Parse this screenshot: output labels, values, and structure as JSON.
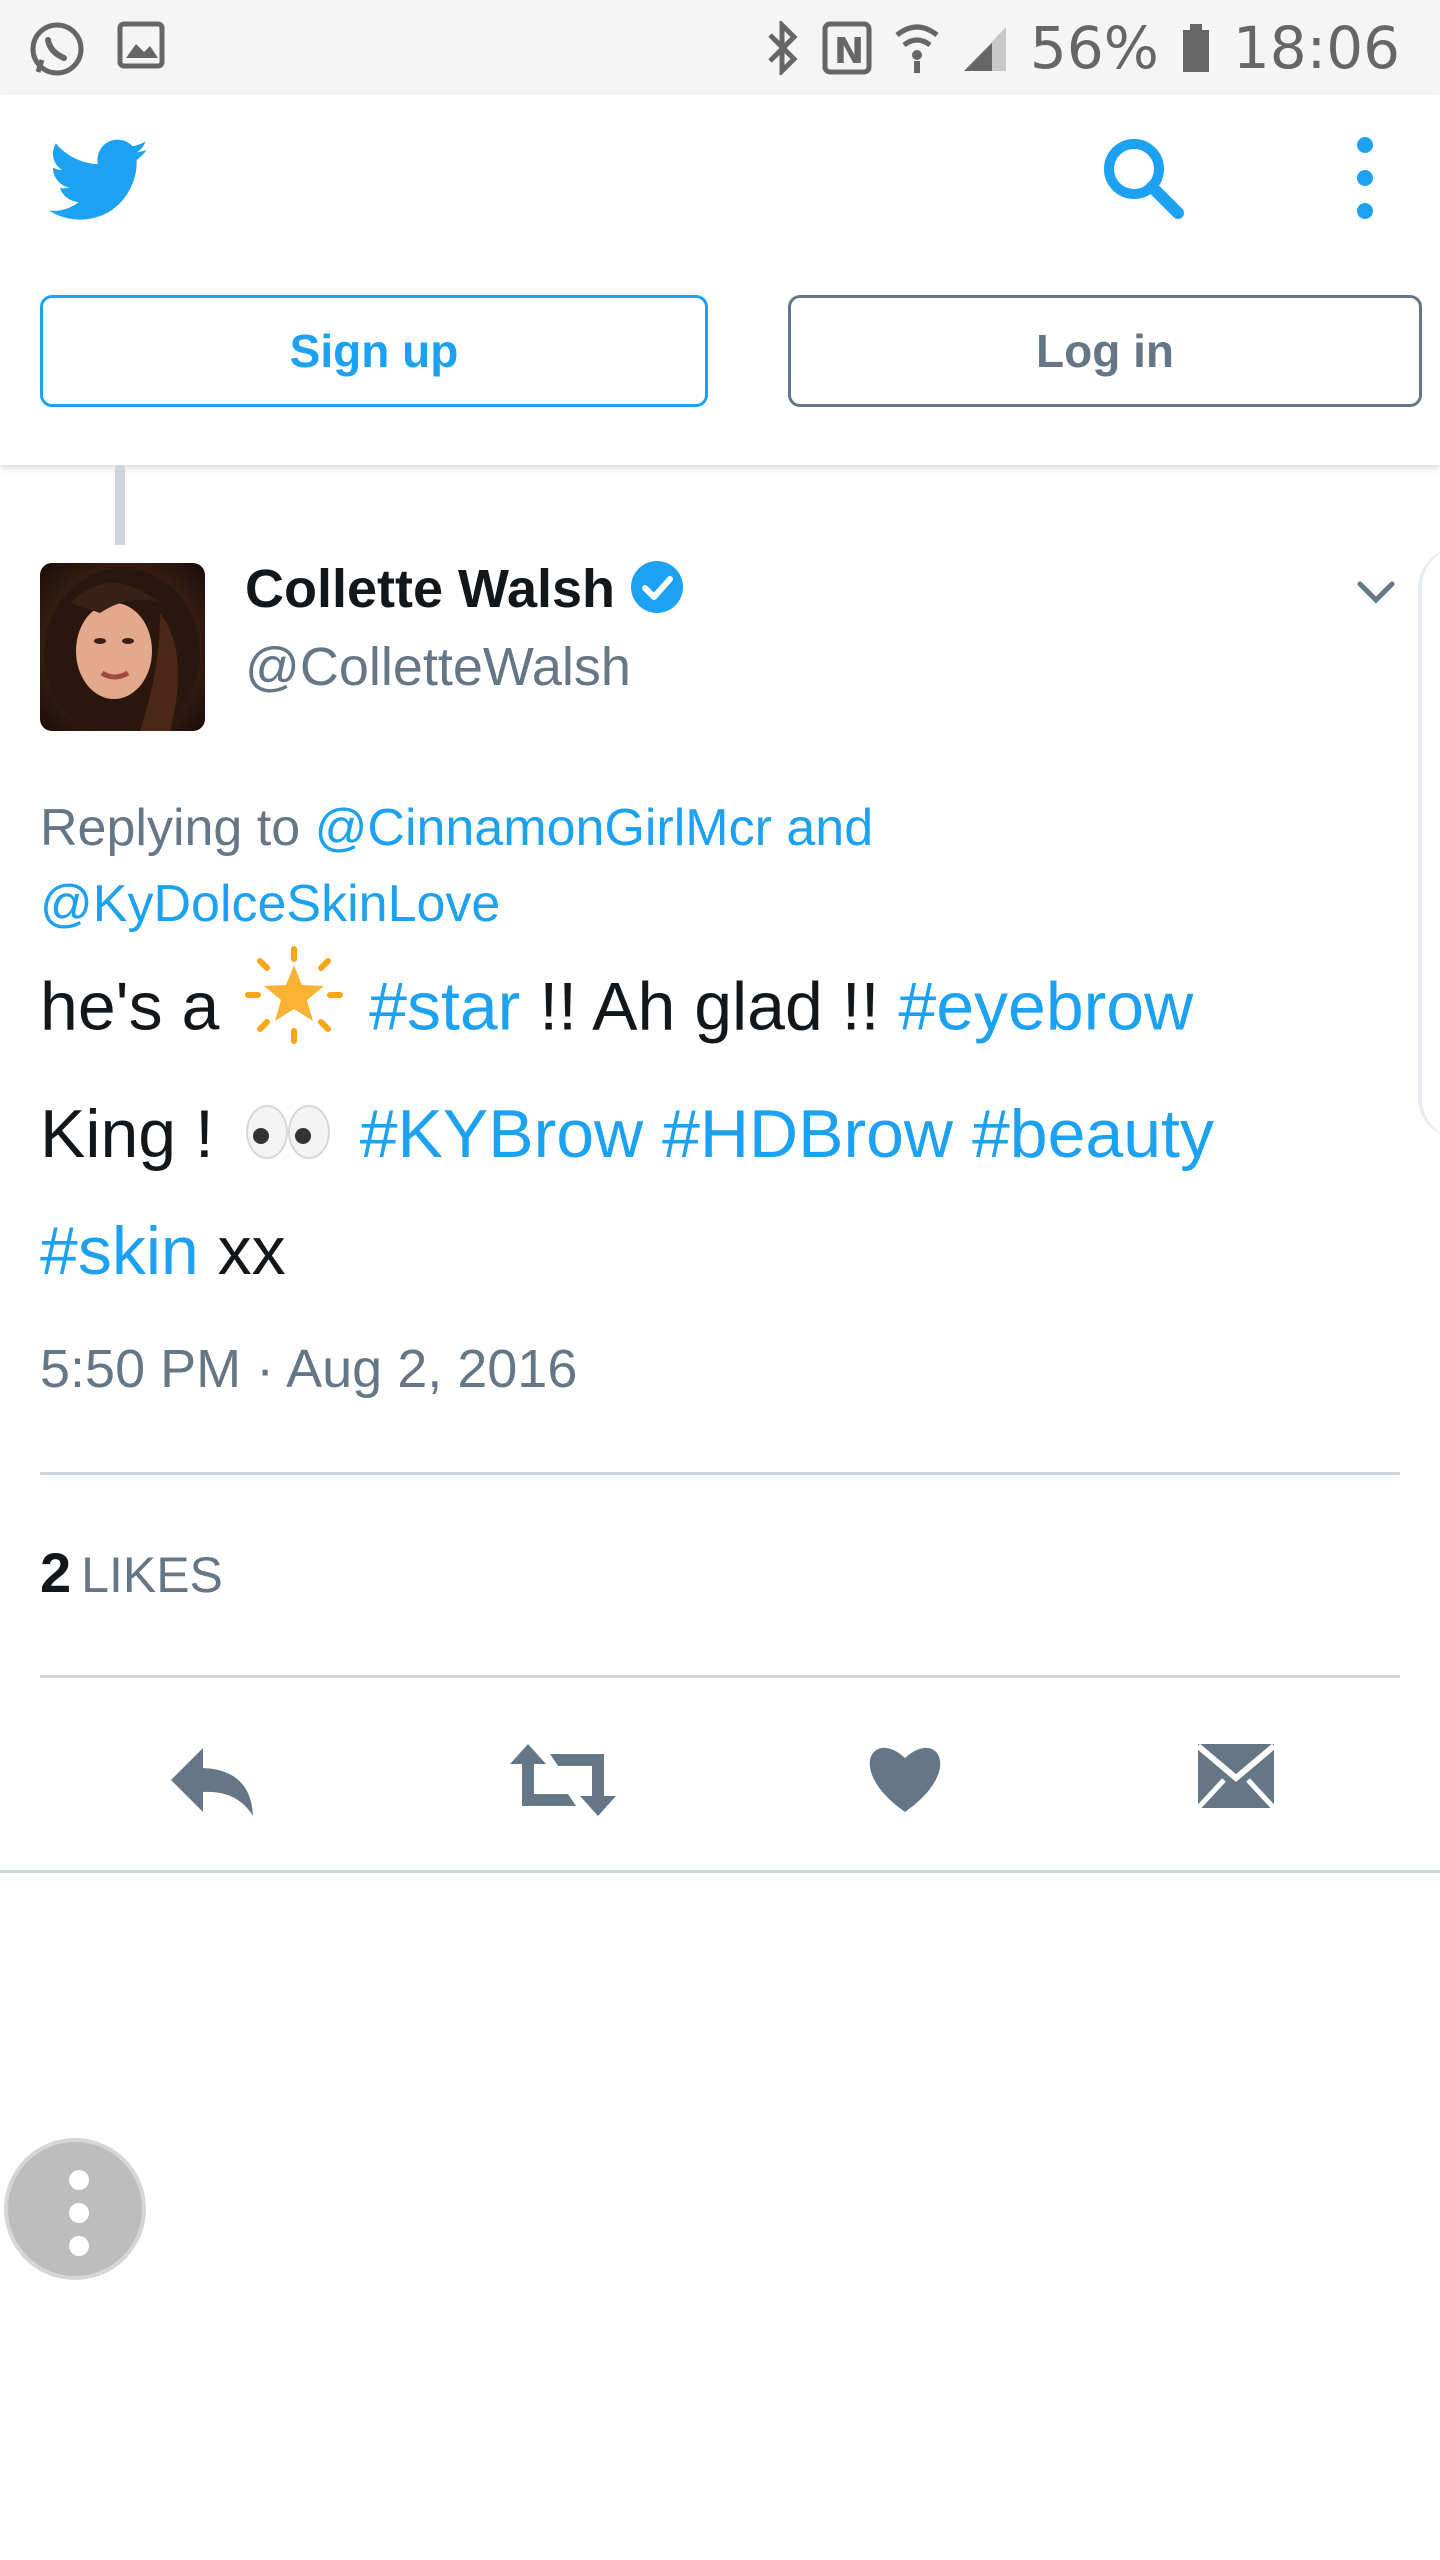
{
  "status_bar": {
    "battery_text": "56%",
    "time": "18:06"
  },
  "header": {
    "logo": "twitter-bird-icon",
    "signup_label": "Sign up",
    "login_label": "Log in"
  },
  "tweet": {
    "name": "Collette Walsh",
    "handle": "@ColletteWalsh",
    "verified": true,
    "replying_prefix": "Replying to",
    "reply_user1": "@CinnamonGirlMcr",
    "reply_and": "and",
    "reply_user2": "@KyDolceSkinLove",
    "text_1": "he's a",
    "tag_star": "#star",
    "text_2": "!! Ah glad !!",
    "tag_eyebrow": "#eyebrow",
    "text_3": "King !",
    "tag_kybrow": "#KYBrow",
    "tag_hdbrow": "#HDBrow",
    "tag_beauty": "#beauty",
    "tag_skin": "#skin",
    "text_4": "xx",
    "timestamp": "5:50 PM · Aug 2, 2016",
    "likes_count": "2",
    "likes_label": "LIKES"
  },
  "colors": {
    "brand": "#1da1f2",
    "secondary_text": "#657786",
    "divider": "#ccd6dd"
  }
}
